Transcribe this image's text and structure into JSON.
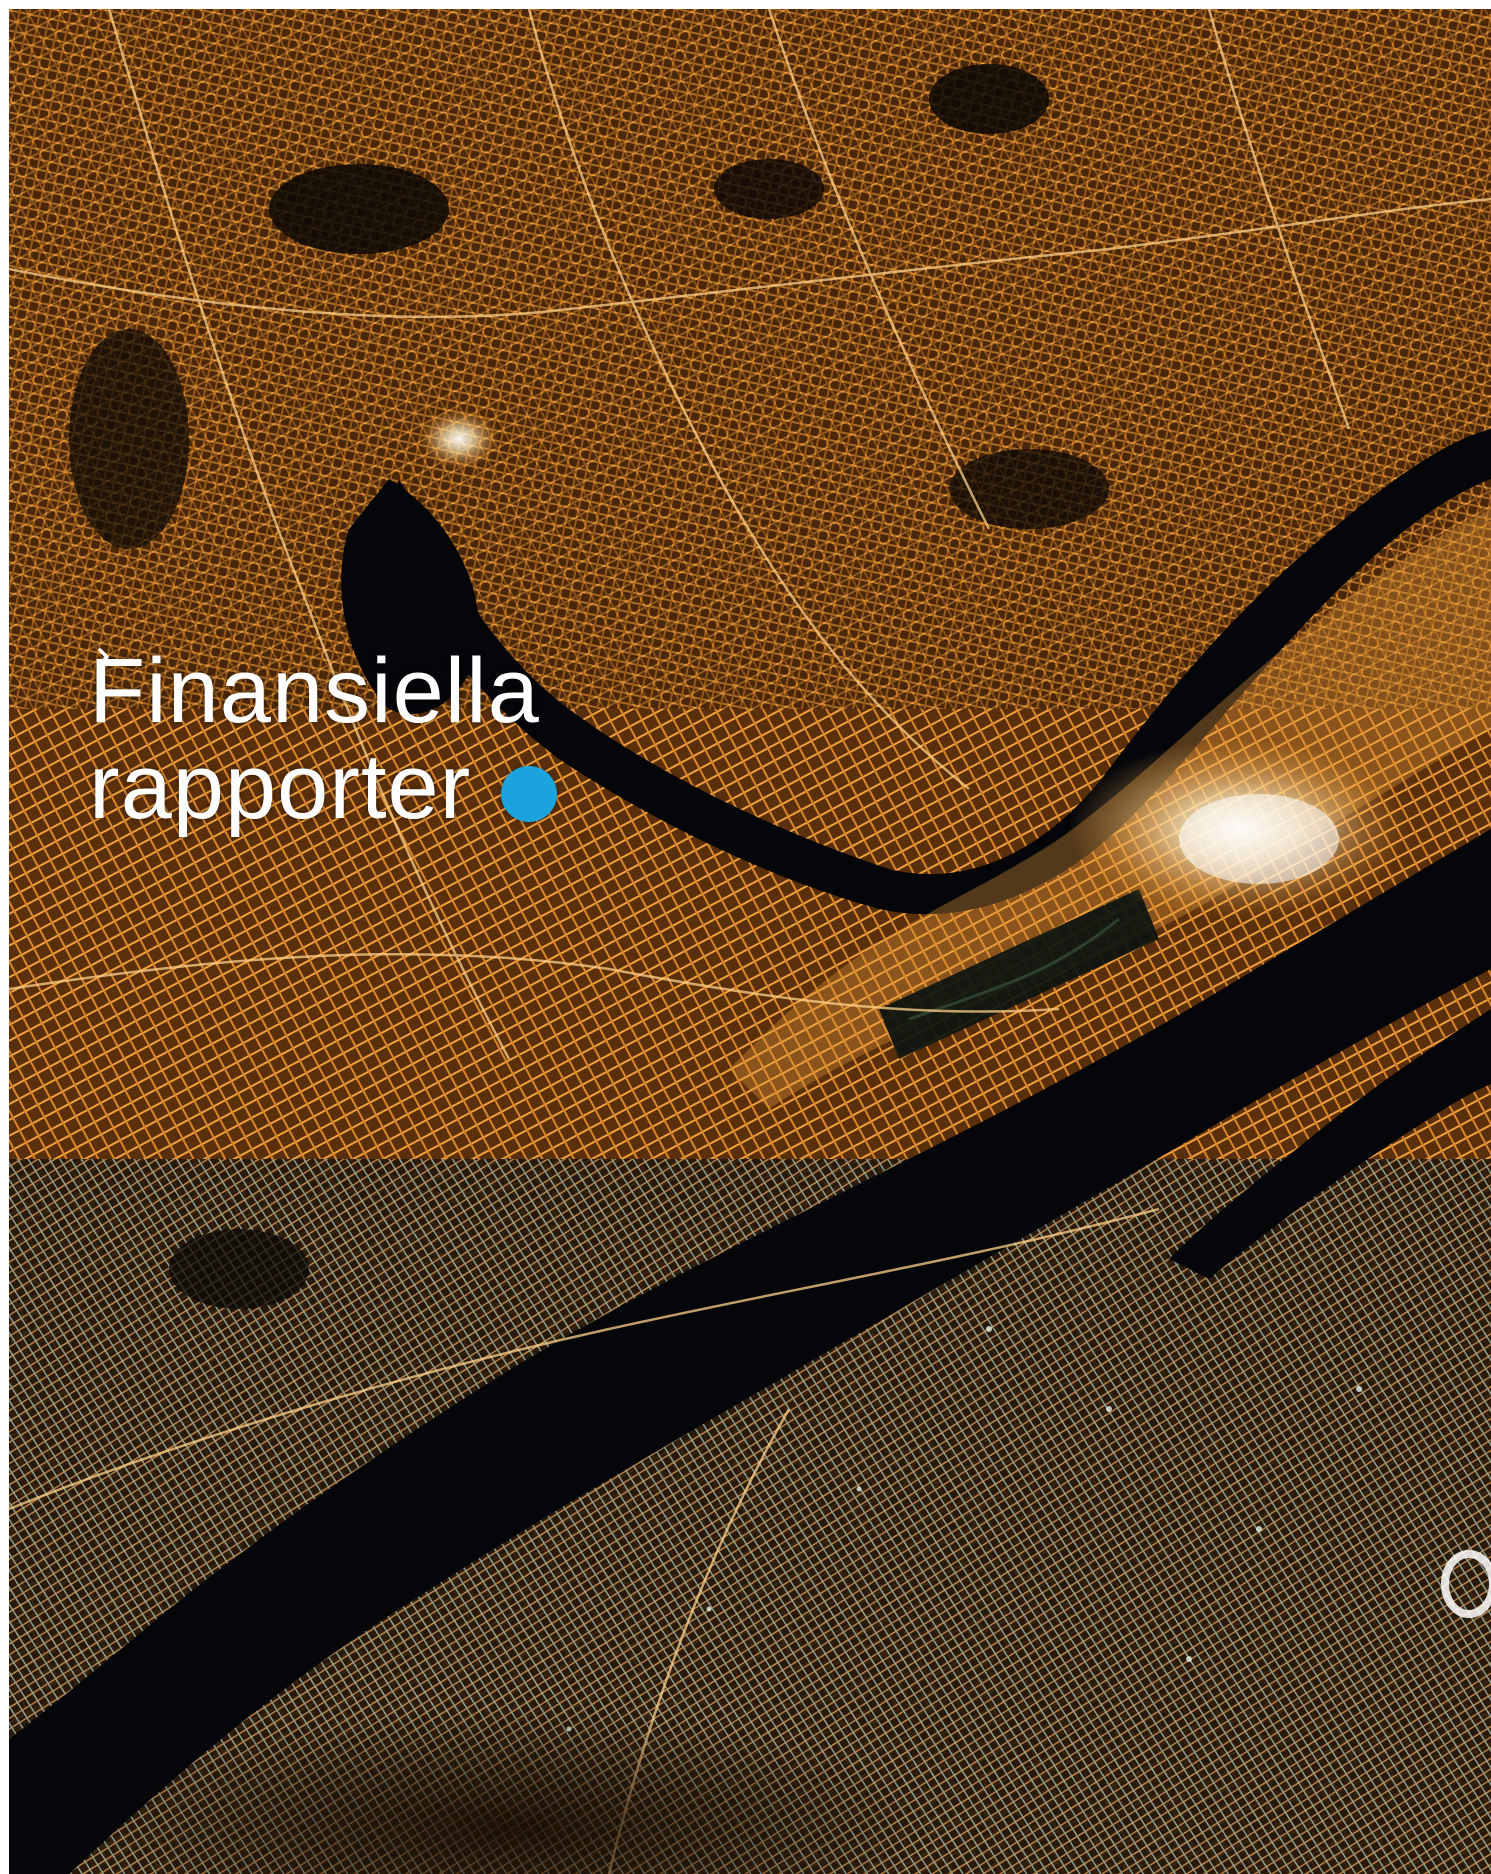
{
  "hero": {
    "title_line1": "Finansiella",
    "title_line2": "rapporter"
  },
  "colors": {
    "arrow_button_bg": "#1aa3dc",
    "city_lights": "#e3942f",
    "bright_lights": "#fff4d6",
    "water": "#05060a"
  },
  "icons": {
    "arrow": "chevron-right-icon"
  }
}
